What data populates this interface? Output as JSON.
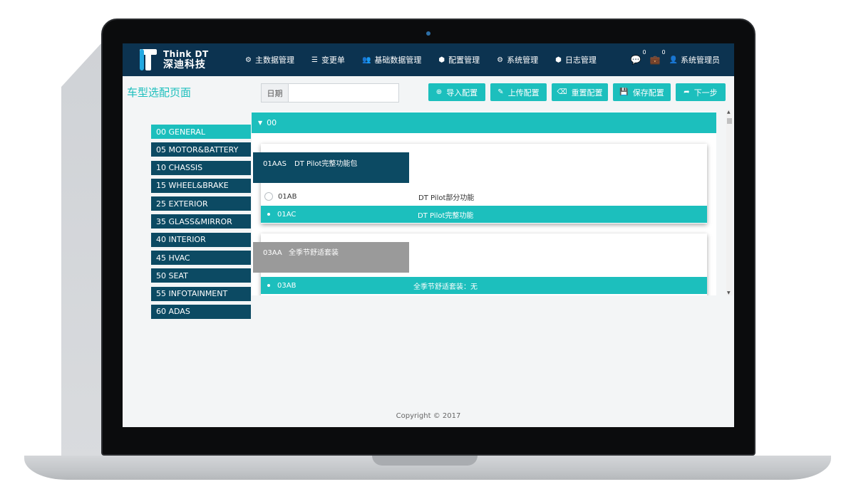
{
  "brand": {
    "en": "Think DT",
    "cn": "深迪科技"
  },
  "nav": {
    "items": [
      {
        "label": "主数据管理",
        "icon": "sitemap-icon",
        "glyph": "⚙"
      },
      {
        "label": "变更单",
        "icon": "list-icon",
        "glyph": "☰"
      },
      {
        "label": "基础数据管理",
        "icon": "users-icon",
        "glyph": "👥"
      },
      {
        "label": "配置管理",
        "icon": "cube-icon",
        "glyph": "⬢"
      },
      {
        "label": "系统管理",
        "icon": "cogs-icon",
        "glyph": "⚙"
      },
      {
        "label": "日志管理",
        "icon": "cube-icon",
        "glyph": "⬢"
      }
    ],
    "messages_count": "0",
    "tasks_count": "0",
    "user": "系统管理员"
  },
  "page": {
    "title": "车型选配页面",
    "date_label": "日期",
    "date_value": ""
  },
  "toolbar": [
    {
      "label": "导入配置",
      "icon": "import-icon",
      "glyph": "⊕"
    },
    {
      "label": "上传配置",
      "icon": "edit-icon",
      "glyph": "✎"
    },
    {
      "label": "重置配置",
      "icon": "eraser-icon",
      "glyph": "⌫"
    },
    {
      "label": "保存配置",
      "icon": "save-icon",
      "glyph": "💾"
    },
    {
      "label": "下一步",
      "icon": "share-icon",
      "glyph": "➦"
    }
  ],
  "categories": [
    "00 GENERAL",
    "05 MOTOR&BATTERY",
    "10 CHASSIS",
    "15 WHEEL&BRAKE",
    "25 EXTERIOR",
    "35 GLASS&MIRROR",
    "40 INTERIOR",
    "45 HVAC",
    "50 SEAT",
    "55 INFOTAINMENT",
    "60 ADAS"
  ],
  "section": {
    "label": "00"
  },
  "cards": [
    {
      "code": "01AAS",
      "desc": "DT Pilot完整功能包",
      "options": [
        {
          "code": "01AB",
          "desc": "DT Pilot部分功能",
          "selected": false
        },
        {
          "code": "01AC",
          "desc": "DT Pilot完整功能",
          "selected": true
        }
      ]
    },
    {
      "code": "03AA",
      "desc": "全季节舒适套装",
      "options": [
        {
          "code": "03AB",
          "desc": "全季节舒适套装：无",
          "selected": true
        }
      ]
    }
  ],
  "footer": "Copyright © 2017",
  "colors": {
    "navbar": "#0c3350",
    "accent": "#1cbfbd",
    "category": "#0c4a63",
    "grey_tag": "#9a9a9a"
  }
}
